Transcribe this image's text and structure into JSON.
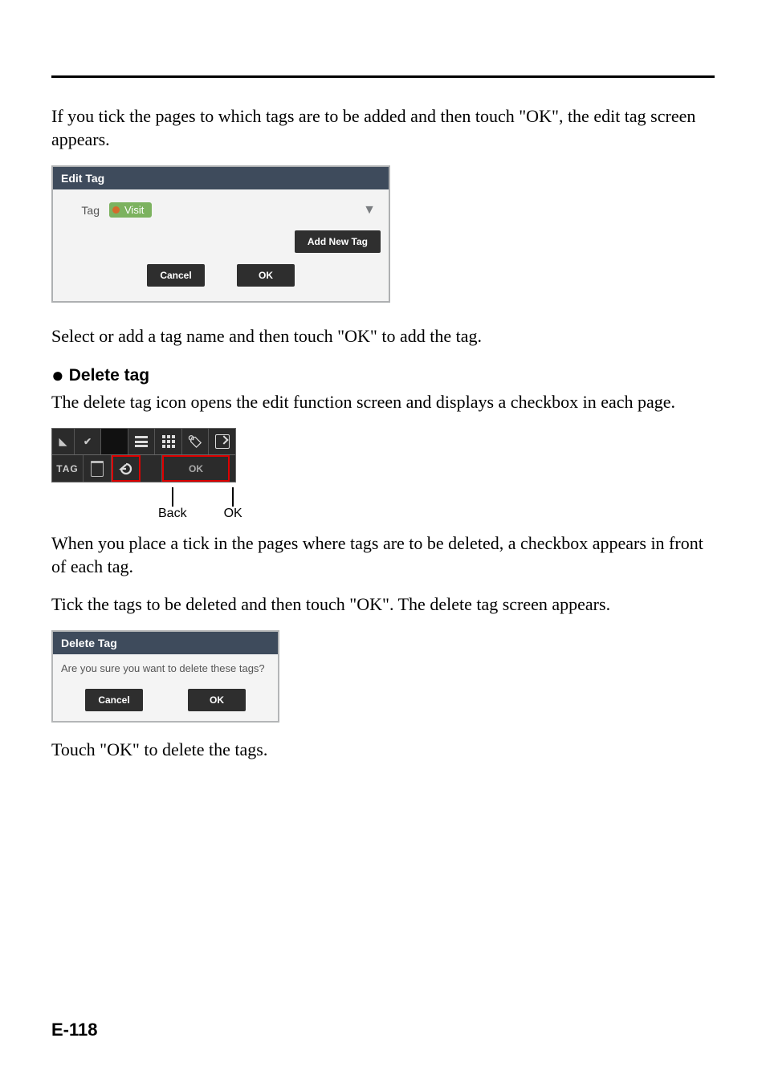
{
  "intro": "If you tick the pages to which tags are to be added and then touch \"OK\", the edit tag screen appears.",
  "editTagPanel": {
    "title": "Edit Tag",
    "tagLabel": "Tag",
    "tagValue": "Visit",
    "addNew": "Add New Tag",
    "cancel": "Cancel",
    "ok": "OK"
  },
  "afterEdit": "Select or add a tag name and then touch \"OK\" to add the tag.",
  "deleteHeading": "Delete tag",
  "deleteIntro": "The delete tag icon opens the edit function screen and displays a checkbox in each page.",
  "toolbar": {
    "tagLabel": "TAG",
    "okLabel": "OK",
    "calloutBack": "Back",
    "calloutOK": "OK"
  },
  "deletePara1": "When you place a tick in the pages where tags are to be deleted, a checkbox appears in front of each tag.",
  "deletePara2": "Tick the tags to be deleted and then touch \"OK\". The delete tag screen appears.",
  "deletePanel": {
    "title": "Delete Tag",
    "message": "Are you sure you want to delete these tags?",
    "cancel": "Cancel",
    "ok": "OK"
  },
  "deleteFinal": "Touch \"OK\" to delete the tags.",
  "pageNum": "E-118"
}
